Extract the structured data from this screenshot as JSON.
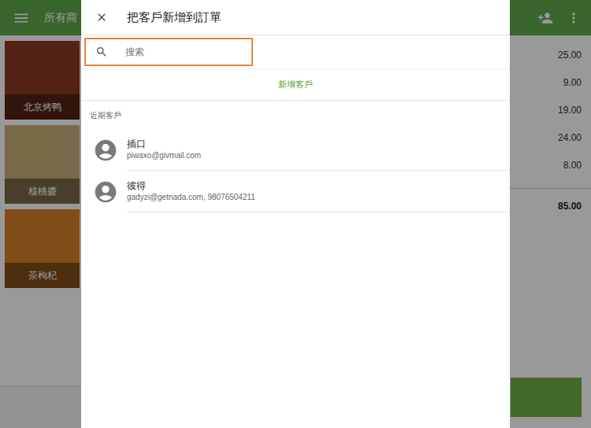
{
  "app": {
    "title": "所有商",
    "products": [
      {
        "name": "北京烤鸭",
        "color": "#8a3a22"
      },
      {
        "name": "核桃醬",
        "color": "#c8b07a"
      },
      {
        "name": "茶枸杞",
        "color": "#d6802a"
      }
    ],
    "order_lines": [
      {
        "price": "25.00"
      },
      {
        "price": "9.00"
      },
      {
        "price": "19.00"
      },
      {
        "price": "24.00"
      },
      {
        "price": "8.00"
      }
    ],
    "total": "85.00"
  },
  "dialog": {
    "title": "把客戶新增到訂單",
    "search": {
      "placeholder": "搜索",
      "focused": true
    },
    "add_customer": "新增客戶",
    "recent_label": "近期客戶",
    "customers": [
      {
        "name": "插口",
        "detail": "piwaxo@givmail.com"
      },
      {
        "name": "彼得",
        "detail": "gadyzi@getnada.com, 98076504211"
      }
    ]
  }
}
